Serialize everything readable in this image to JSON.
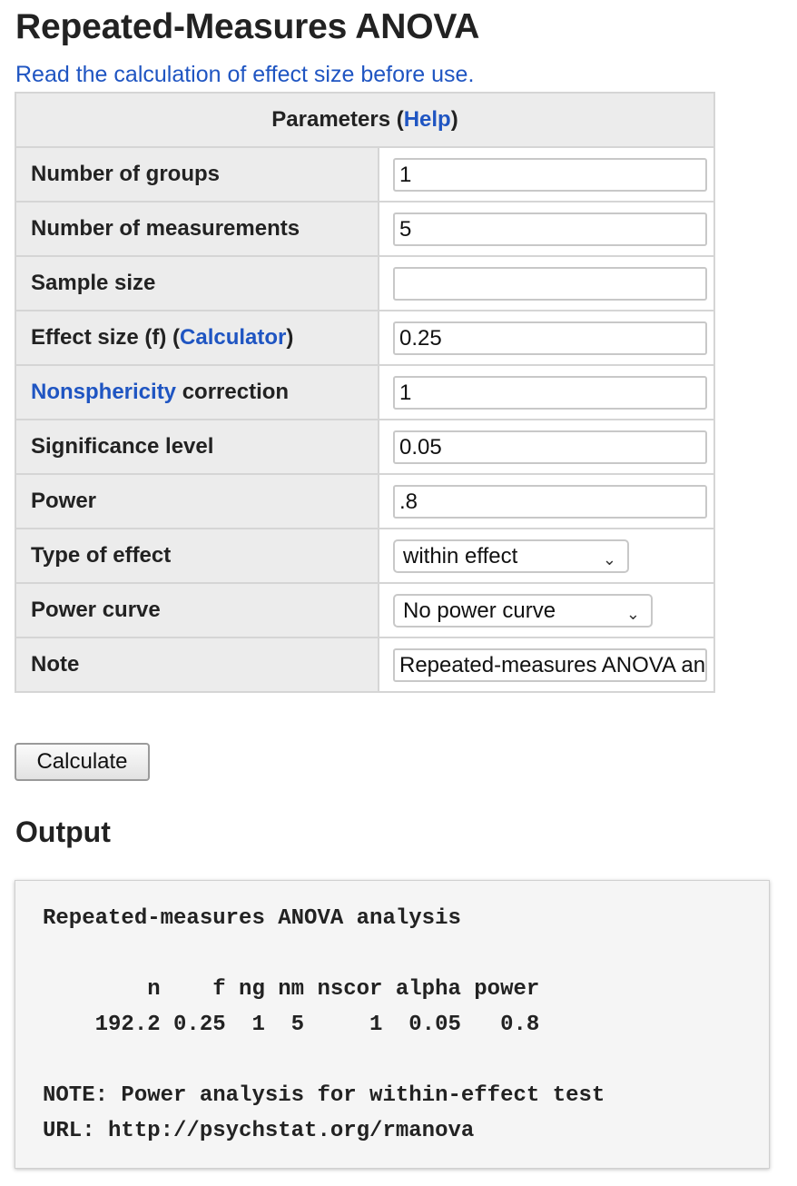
{
  "page": {
    "title": "Repeated-Measures ANOVA",
    "notice_link": "Read the calculation of effect size before use."
  },
  "params": {
    "header_prefix": "Parameters (",
    "header_link": "Help",
    "header_suffix": ")",
    "number_of_groups": {
      "label": "Number of groups",
      "value": "1"
    },
    "number_of_measurements": {
      "label": "Number of measurements",
      "value": "5"
    },
    "sample_size": {
      "label": "Sample size",
      "value": ""
    },
    "effect_size": {
      "label_prefix": "Effect size (f) (",
      "label_link": "Calculator",
      "label_suffix": ")",
      "value": "0.25"
    },
    "nonsphericity": {
      "label_link": "Nonsphericity",
      "label_suffix": " correction",
      "value": "1"
    },
    "significance_level": {
      "label": "Significance level",
      "value": "0.05"
    },
    "power": {
      "label": "Power",
      "value": ".8"
    },
    "type_of_effect": {
      "label": "Type of effect",
      "selected": "within effect"
    },
    "power_curve": {
      "label": "Power curve",
      "selected": "No power curve"
    },
    "note": {
      "label": "Note",
      "value": "Repeated-measures ANOVA analysis"
    }
  },
  "calculate_label": "Calculate",
  "output": {
    "heading": "Output",
    "text": "Repeated-measures ANOVA analysis\n\n        n    f ng nm nscor alpha power\n    192.2 0.25  1  5     1  0.05   0.8\n\nNOTE: Power analysis for within-effect test\nURL: http://psychstat.org/rmanova"
  },
  "colors": {
    "link": "#1f55c2",
    "label_bg": "#ececec",
    "border": "#d5d5d5",
    "output_bg": "#f5f5f5"
  }
}
